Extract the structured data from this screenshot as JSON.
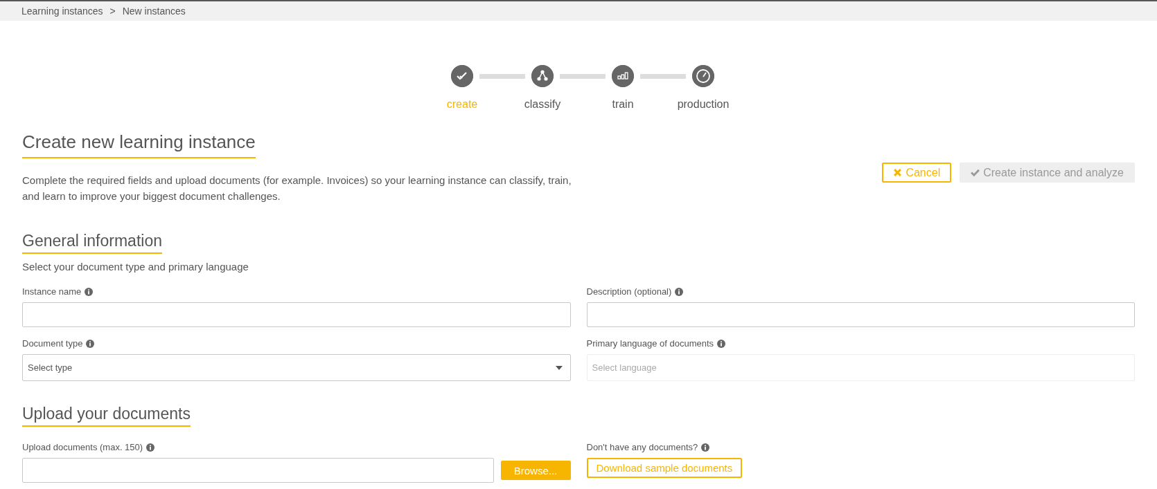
{
  "breadcrumb": [
    "Learning instances",
    "New instances"
  ],
  "breadcrumb_separator": ">",
  "steps": [
    {
      "label": "create",
      "selected": true
    },
    {
      "label": "classify",
      "selected": false
    },
    {
      "label": "train",
      "selected": false
    },
    {
      "label": "production",
      "selected": false
    }
  ],
  "title": "Create new learning instance",
  "intro": "Complete the required fields and upload documents (for example. Invoices) so your learning instance can classify, train, and learn to improve your biggest document challenges.",
  "actions": [
    {
      "label": "Cancel",
      "kind": "cancel",
      "disabled": false
    },
    {
      "label": "Create instance and analyze",
      "kind": "confirm",
      "disabled": true
    }
  ],
  "general": {
    "heading": "General information",
    "subtitle": "Select your document type and primary language",
    "fields": [
      {
        "label": "Instance name",
        "kind": "text",
        "disabled": false
      },
      {
        "label": "Description (optional)",
        "kind": "text",
        "disabled": false
      },
      {
        "label": "Document type",
        "kind": "select",
        "placeholder": "Select type",
        "disabled": false
      },
      {
        "label": "Primary language of documents",
        "kind": "select",
        "placeholder": "Select language",
        "disabled": true
      }
    ]
  },
  "upload": {
    "heading": "Upload your documents",
    "field_label": "Upload documents (max. 150)",
    "browse": "Browse...",
    "help_label": "Don't have any documents?",
    "sample_button": "Download sample documents"
  }
}
